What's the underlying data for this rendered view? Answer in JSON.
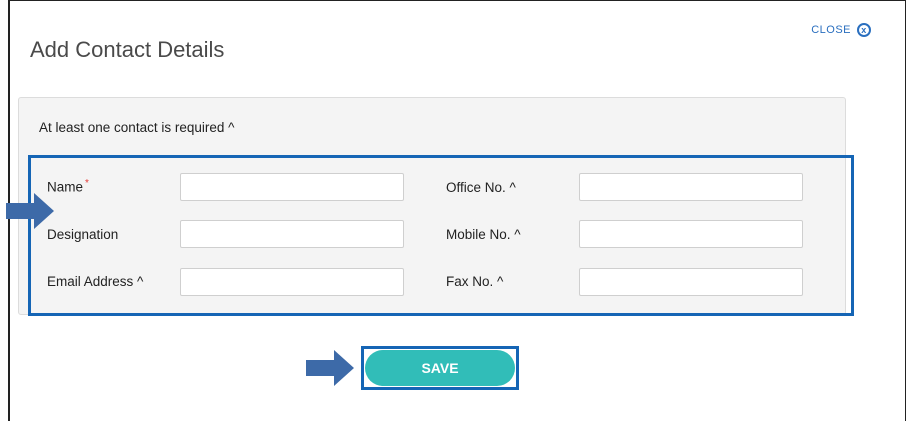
{
  "dialog": {
    "title": "Add Contact Details",
    "close_label": "CLOSE",
    "close_icon": "close-circle-icon",
    "note": "At least one contact is required ^"
  },
  "fields": {
    "name": {
      "label": "Name",
      "required_marker": "*",
      "value": ""
    },
    "designation": {
      "label": "Designation",
      "value": ""
    },
    "email": {
      "label": "Email Address ^",
      "value": ""
    },
    "office": {
      "label": "Office No. ^",
      "value": ""
    },
    "mobile": {
      "label": "Mobile No. ^",
      "value": ""
    },
    "fax": {
      "label": "Fax No. ^",
      "value": ""
    }
  },
  "actions": {
    "save_label": "SAVE"
  },
  "colors": {
    "accent_blue": "#1565b5",
    "save_teal": "#31bdb8",
    "required_red": "#e53935",
    "arrow_blue": "#3d6aa8"
  }
}
